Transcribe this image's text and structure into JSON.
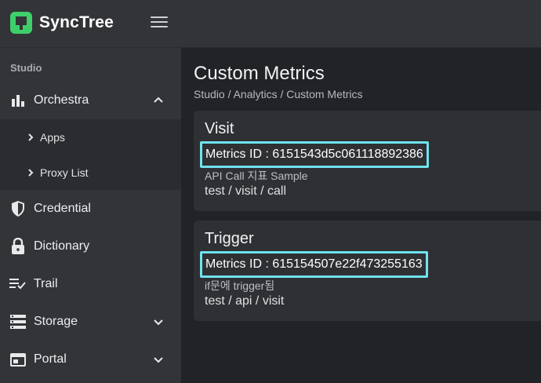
{
  "app": {
    "name": "SyncTree"
  },
  "sidebar": {
    "section_label": "Studio",
    "items": [
      {
        "label": "Orchestra",
        "icon": "bar-chart-icon",
        "expanded": true,
        "children": [
          {
            "label": "Apps"
          },
          {
            "label": "Proxy List"
          }
        ]
      },
      {
        "label": "Credential",
        "icon": "shield-icon"
      },
      {
        "label": "Dictionary",
        "icon": "lock-icon"
      },
      {
        "label": "Trail",
        "icon": "list-check-icon"
      },
      {
        "label": "Storage",
        "icon": "storage-icon",
        "expandable": true
      },
      {
        "label": "Portal",
        "icon": "browser-window-icon",
        "expandable": true
      }
    ]
  },
  "main": {
    "title": "Custom Metrics",
    "breadcrumb": "Studio / Analytics / Custom Metrics",
    "cards": [
      {
        "title": "Visit",
        "metric_id": "Metrics ID : 6151543d5c061118892386",
        "description": "API Call 지표 Sample",
        "path": "test / visit / call"
      },
      {
        "title": "Trigger",
        "metric_id": "Metrics ID : 615154507e22f473255163",
        "description": "if문에 trigger됨",
        "path": "test / api / visit"
      }
    ]
  },
  "colors": {
    "accent_green": "#3ecf6b",
    "highlight_cyan": "#6fe3ee",
    "sidebar_bg": "#333438",
    "main_bg": "#222327",
    "card_bg": "#2f3034"
  }
}
